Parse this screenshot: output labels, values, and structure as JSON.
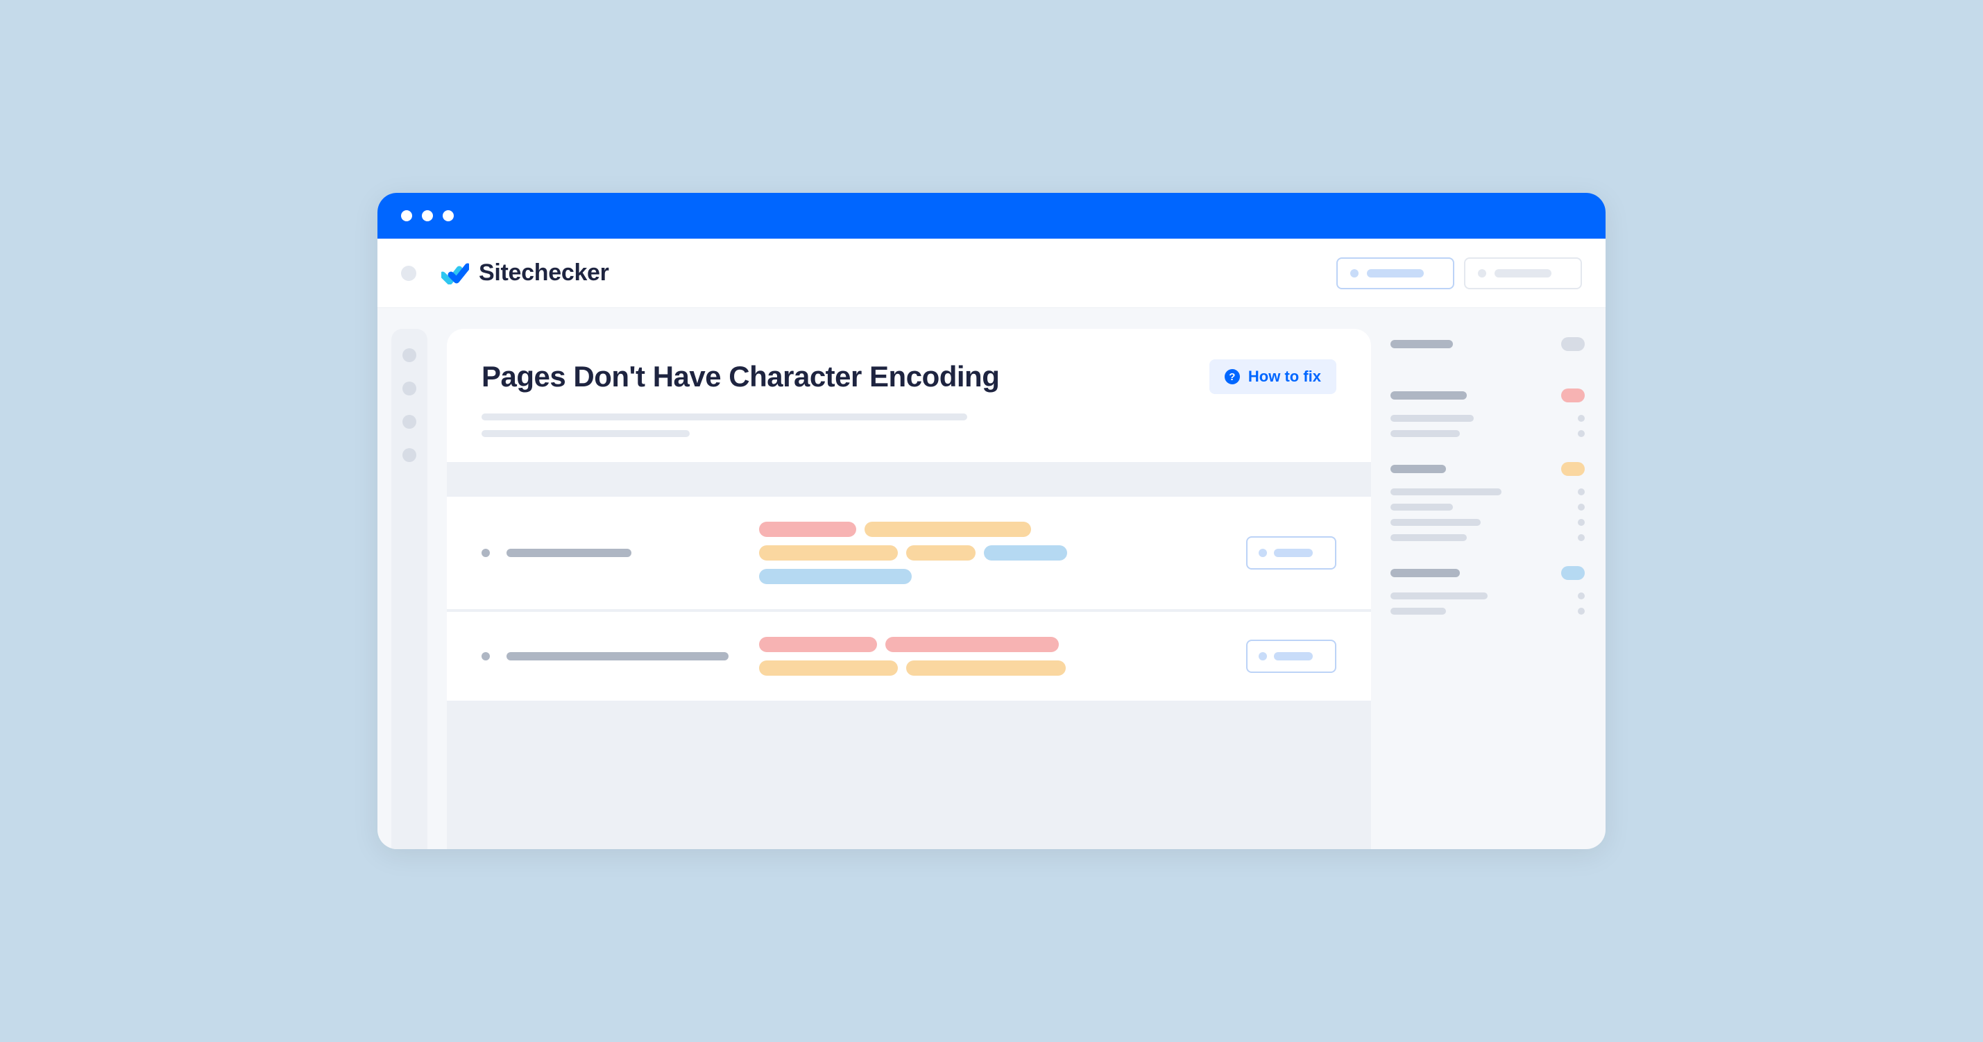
{
  "app": {
    "name": "Sitechecker"
  },
  "main": {
    "heading": "Pages Don't Have Character Encoding",
    "how_to_fix_label": "How to fix"
  },
  "colors": {
    "accent": "#0066ff",
    "bg": "#c5daea",
    "red": "#f7b3b3",
    "orange": "#fad7a0",
    "blue": "#b5d9f2",
    "gray": "#aeb6c3"
  }
}
